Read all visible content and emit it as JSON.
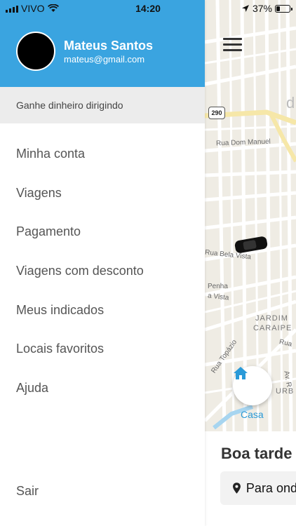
{
  "status_bar": {
    "carrier": "VIVO",
    "time": "14:20",
    "battery_text": "37%"
  },
  "drawer": {
    "user_name": "Mateus Santos",
    "user_email": "mateus@gmail.com",
    "promo_label": "Ganhe dinheiro dirigindo",
    "menu_items": [
      {
        "label": "Minha conta"
      },
      {
        "label": "Viagens"
      },
      {
        "label": "Pagamento"
      },
      {
        "label": "Viagens com desconto"
      },
      {
        "label": "Meus indicados"
      },
      {
        "label": "Locais favoritos"
      },
      {
        "label": "Ajuda"
      }
    ],
    "logout_label": "Sair"
  },
  "map": {
    "route_shield": "290",
    "streets": [
      "Rua Dom Manuel",
      "Rua Bela Vista",
      "Penha",
      "a Vista",
      "Rua Topázio",
      "Rua",
      "Av. R"
    ],
    "districts": [
      "JARDIM",
      "CARAIPE",
      "URB",
      "d"
    ],
    "home_label": "Casa"
  },
  "bottom": {
    "greeting": "Boa tarde",
    "destination_placeholder": "Para onde"
  },
  "colors": {
    "header_blue": "#3aa4e0",
    "accent_blue": "#2a9ad8",
    "promo_bg": "#ececec",
    "map_bg": "#efece4"
  }
}
